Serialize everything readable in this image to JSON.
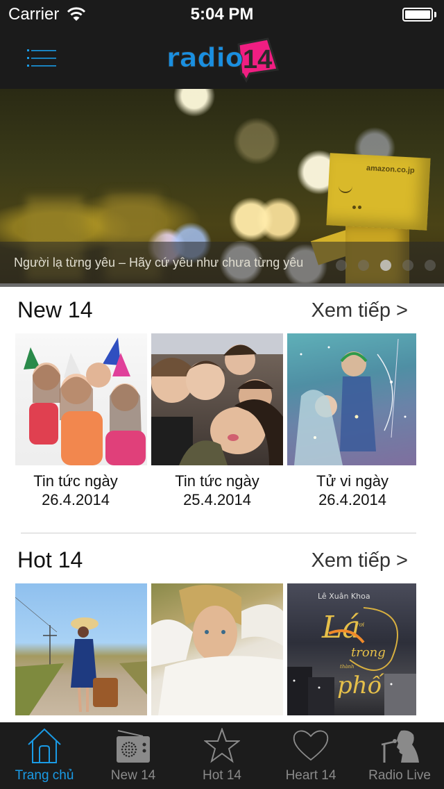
{
  "status_bar": {
    "carrier": "Carrier",
    "time": "5:04 PM",
    "wifi_icon": "wifi-icon",
    "battery_icon": "battery-full-icon"
  },
  "nav_bar": {
    "menu_icon": "list-menu-icon",
    "logo_text": "radio",
    "logo_badge": "14",
    "colors": {
      "logo_blue": "#1a8fe0",
      "logo_pink": "#f01e82",
      "menu_blue": "#1a9be6"
    }
  },
  "banner": {
    "caption": "Người lạ từng yêu – Hãy cứ yêu như chưa từng yêu",
    "image_box_label": "amazon.co.jp",
    "page_count": 5,
    "active_page": 3
  },
  "sections": [
    {
      "title": "New 14",
      "see_more": "Xem tiếp >",
      "items": [
        {
          "caption_line1": "Tin tức ngày",
          "caption_line2": "26.4.2014",
          "image": "party-girls-photo"
        },
        {
          "caption_line1": "Tin tức ngày",
          "caption_line2": "25.4.2014",
          "image": "band-selfie-photo"
        },
        {
          "caption_line1": "Tử vi ngày",
          "caption_line2": "26.4.2014",
          "image": "fantasy-couple-art"
        }
      ]
    },
    {
      "title": "Hot 14",
      "see_more": "Xem tiếp >",
      "items": [
        {
          "image": "woman-with-suitcase-photo"
        },
        {
          "image": "man-in-grass-photo"
        },
        {
          "image": "album-cover",
          "cover_artist": "Lê Xuân Khoa",
          "cover_title_1": "Lá",
          "cover_title_2": "rơi",
          "cover_title_3": "trong",
          "cover_title_4": "thành",
          "cover_title_5": "phố"
        }
      ]
    }
  ],
  "tab_bar": {
    "active_color": "#1a9be6",
    "inactive_color": "#8a8a8a",
    "tabs": [
      {
        "label": "Trang chủ",
        "icon": "home-icon",
        "active": true
      },
      {
        "label": "New 14",
        "icon": "radio-icon",
        "active": false
      },
      {
        "label": "Hot 14",
        "icon": "star-icon",
        "active": false
      },
      {
        "label": "Heart 14",
        "icon": "heart-icon",
        "active": false
      },
      {
        "label": "Radio Live",
        "icon": "singer-microphone-icon",
        "active": false
      }
    ]
  }
}
